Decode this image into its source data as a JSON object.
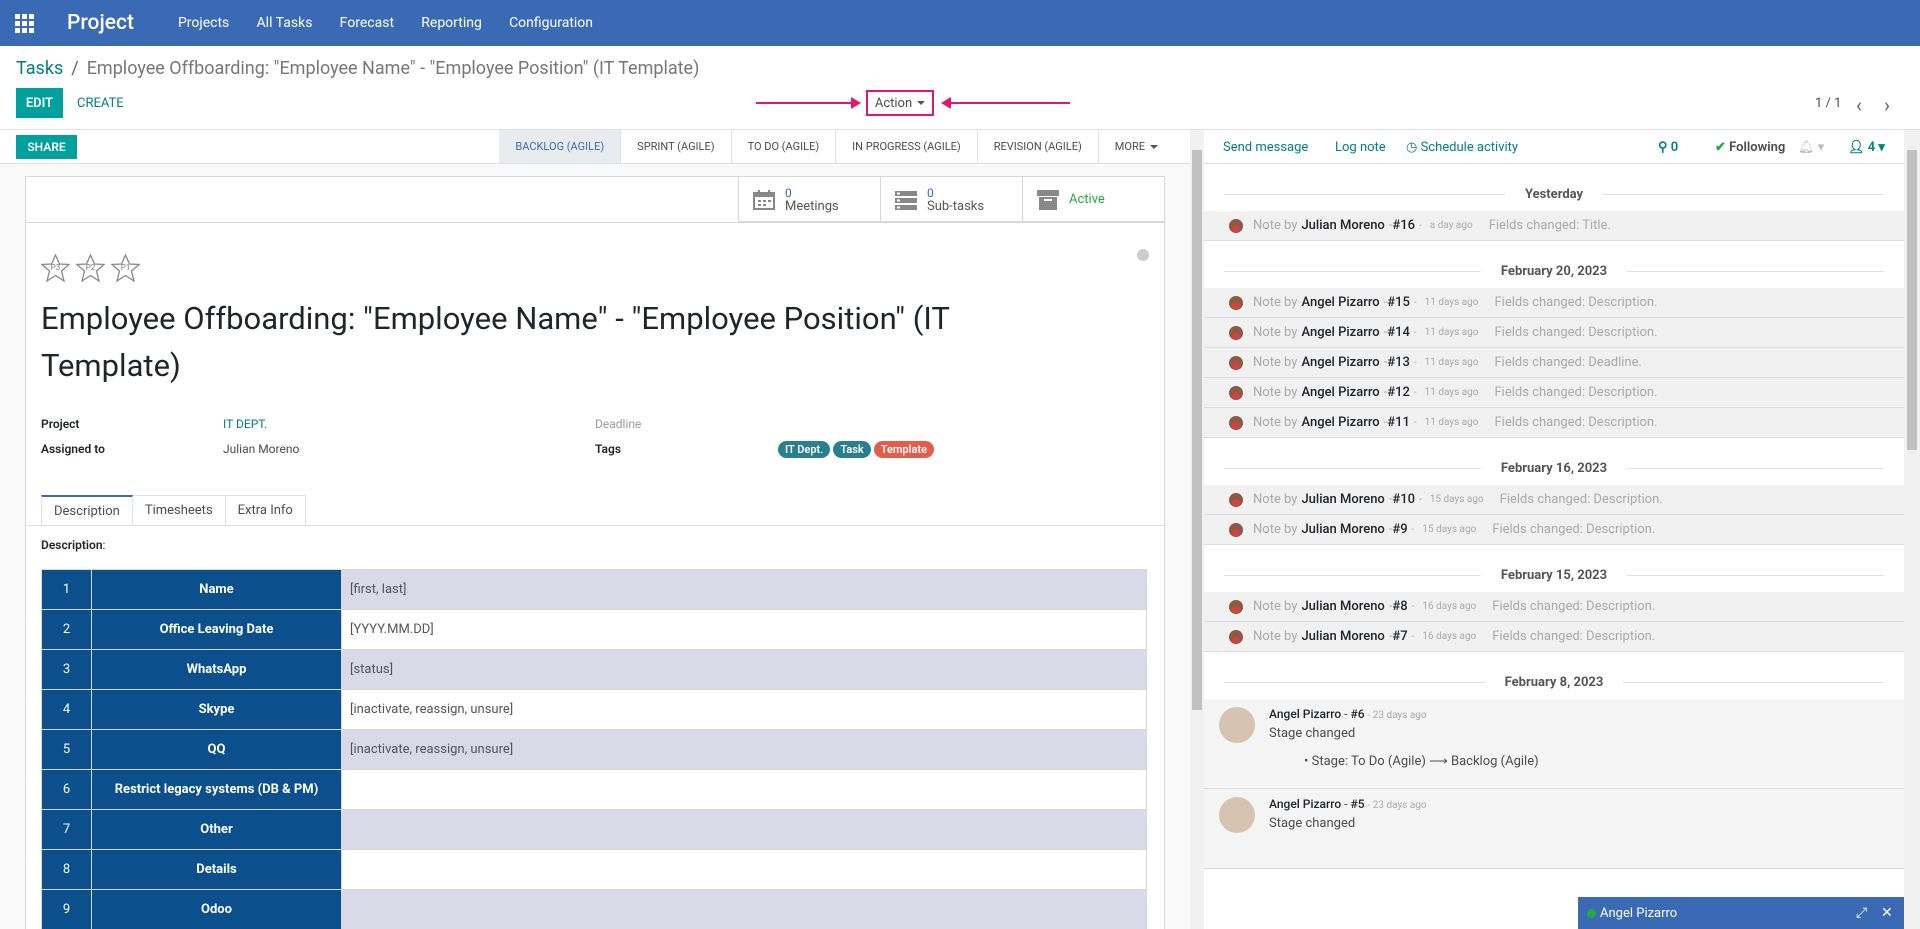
{
  "topbar": {
    "app": "Project",
    "menu": [
      "Projects",
      "All Tasks",
      "Forecast",
      "Reporting",
      "Configuration"
    ]
  },
  "breadcrumb": {
    "parent": "Tasks",
    "sep": "/",
    "current": "Employee Offboarding: \"Employee Name\" - \"Employee Position\" (IT Template)"
  },
  "toolbar": {
    "edit": "EDIT",
    "create": "CREATE",
    "action": "Action",
    "pager": "1 / 1",
    "prev": "‹",
    "next": "›"
  },
  "share": "SHARE",
  "stages": [
    "Backlog (Agile)",
    "Sprint (Agile)",
    "To Do (Agile)",
    "In Progress (Agile)",
    "Revision (Agile)",
    "More"
  ],
  "smart": {
    "meetings_count": "0",
    "meetings": "Meetings",
    "subtasks_count": "0",
    "subtasks": "Sub-tasks",
    "active": "Active"
  },
  "priority": [
    "P3",
    "P2",
    "P1"
  ],
  "task": {
    "title": "Employee Offboarding: \"Employee Name\" - \"Employee Position\" (IT Template)",
    "project_label": "Project",
    "project": "IT DEPT.",
    "assigned_label": "Assigned to",
    "assigned": "Julian Moreno",
    "deadline_label": "Deadline",
    "tags_label": "Tags",
    "tags": [
      {
        "name": "IT Dept.",
        "color": "#2a7f8f"
      },
      {
        "name": "Task",
        "color": "#2a7f8f"
      },
      {
        "name": "Template",
        "color": "#e35d4d"
      }
    ]
  },
  "tabs": [
    "Description",
    "Timesheets",
    "Extra Info"
  ],
  "desc_label": "Description",
  "rows": [
    {
      "n": "1",
      "k": "Name",
      "v": "[first, last]"
    },
    {
      "n": "2",
      "k": "Office Leaving Date",
      "v": "[YYYY.MM.DD]"
    },
    {
      "n": "3",
      "k": "WhatsApp",
      "v": "[status]"
    },
    {
      "n": "4",
      "k": "Skype",
      "v": "[inactivate, reassign, unsure]"
    },
    {
      "n": "5",
      "k": "QQ",
      "v": "[inactivate, reassign, unsure]"
    },
    {
      "n": "6",
      "k": "Restrict legacy systems (DB & PM)",
      "v": ""
    },
    {
      "n": "7",
      "k": "Other",
      "v": ""
    },
    {
      "n": "8",
      "k": "Details",
      "v": ""
    },
    {
      "n": "9",
      "k": "Odoo",
      "v": ""
    }
  ],
  "chatter": {
    "send": "Send message",
    "log": "Log note",
    "schedule": "Schedule activity",
    "attachments": "0",
    "following": "Following",
    "followers": "4",
    "days": [
      {
        "label": "Yesterday",
        "notes": [
          {
            "who": "Julian Moreno",
            "id": "#16",
            "when": "a day ago",
            "chg": "Fields changed: Title."
          }
        ]
      },
      {
        "label": "February 20, 2023",
        "notes": [
          {
            "who": "Angel Pizarro",
            "id": "#15",
            "when": "11 days ago",
            "chg": "Fields changed: Description."
          },
          {
            "who": "Angel Pizarro",
            "id": "#14",
            "when": "11 days ago",
            "chg": "Fields changed: Description."
          },
          {
            "who": "Angel Pizarro",
            "id": "#13",
            "when": "11 days ago",
            "chg": "Fields changed: Deadline."
          },
          {
            "who": "Angel Pizarro",
            "id": "#12",
            "when": "11 days ago",
            "chg": "Fields changed: Description."
          },
          {
            "who": "Angel Pizarro",
            "id": "#11",
            "when": "11 days ago",
            "chg": "Fields changed: Description."
          }
        ]
      },
      {
        "label": "February 16, 2023",
        "notes": [
          {
            "who": "Julian Moreno",
            "id": "#10",
            "when": "15 days ago",
            "chg": "Fields changed: Description."
          },
          {
            "who": "Julian Moreno",
            "id": "#9",
            "when": "15 days ago",
            "chg": "Fields changed: Description."
          }
        ]
      },
      {
        "label": "February 15, 2023",
        "notes": [
          {
            "who": "Julian Moreno",
            "id": "#8",
            "when": "16 days ago",
            "chg": "Fields changed: Description."
          },
          {
            "who": "Julian Moreno",
            "id": "#7",
            "when": "16 days ago",
            "chg": "Fields changed: Description."
          }
        ]
      }
    ],
    "last_day": "February 8, 2023",
    "msg6": {
      "who": "Angel Pizarro",
      "id": "#6",
      "when": "23 days ago",
      "text": "Stage changed",
      "detail": "Stage: To Do (Agile) ⟶ Backlog (Agile)"
    },
    "msg5": {
      "who": "Angel Pizarro",
      "id": "#5",
      "when": "23 days ago",
      "text": "Stage changed"
    },
    "note_by": "Note by"
  },
  "chatwindow": {
    "name": "Angel Pizarro"
  }
}
